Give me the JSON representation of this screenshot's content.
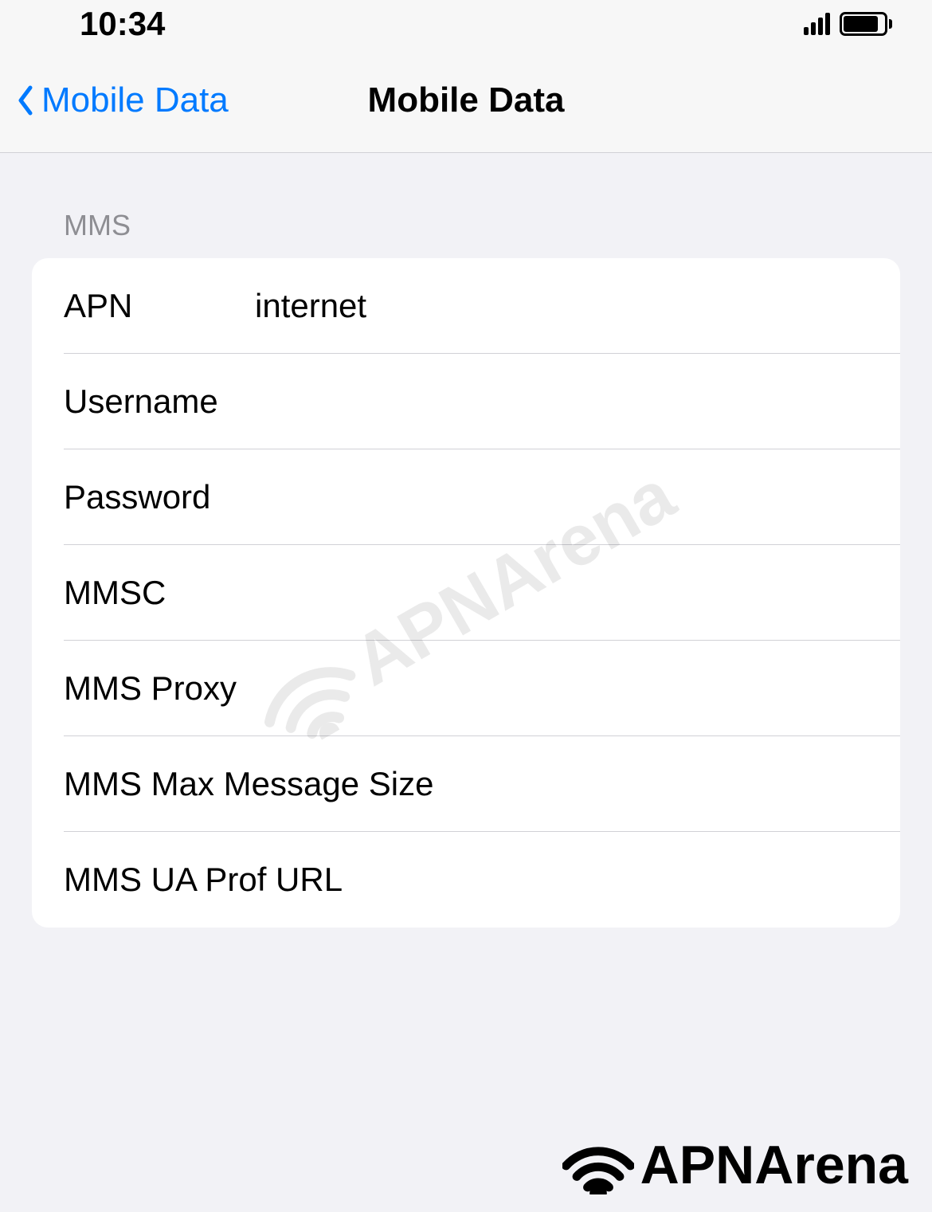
{
  "status_bar": {
    "time": "10:34"
  },
  "nav": {
    "back_label": "Mobile Data",
    "title": "Mobile Data"
  },
  "section": {
    "header": "MMS",
    "rows": [
      {
        "label": "APN",
        "value": "internet"
      },
      {
        "label": "Username",
        "value": ""
      },
      {
        "label": "Password",
        "value": ""
      },
      {
        "label": "MMSC",
        "value": ""
      },
      {
        "label": "MMS Proxy",
        "value": ""
      },
      {
        "label": "MMS Max Message Size",
        "value": ""
      },
      {
        "label": "MMS UA Prof URL",
        "value": ""
      }
    ]
  },
  "watermark": {
    "text": "APNArena"
  },
  "branding": {
    "text": "APNArena"
  }
}
